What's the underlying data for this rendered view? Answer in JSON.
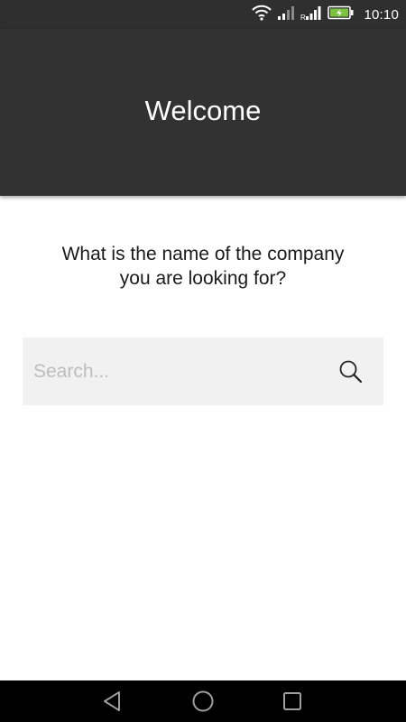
{
  "status_bar": {
    "time": "10:10",
    "icons": [
      "wifi-icon",
      "signal-icon",
      "signal-roaming-icon",
      "battery-charging-icon"
    ],
    "battery_color": "#7cc142"
  },
  "app_bar": {
    "title": "Welcome",
    "background": "#323232"
  },
  "main": {
    "prompt": "What is the name of the company\nyou are looking for?",
    "search": {
      "placeholder": "Search...",
      "value": "",
      "icon": "search-icon"
    }
  },
  "nav_bar": {
    "buttons": [
      "back-icon",
      "home-icon",
      "recents-icon"
    ]
  }
}
